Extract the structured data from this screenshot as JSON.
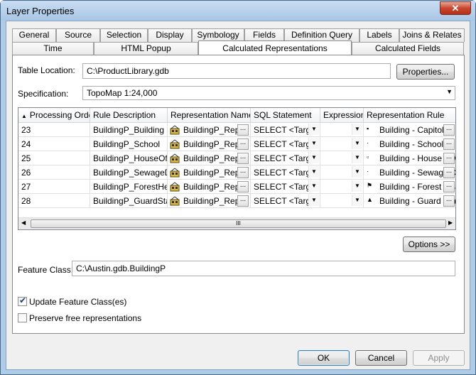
{
  "window": {
    "title": "Layer Properties",
    "close_label": "✕"
  },
  "tabs_row1": [
    "General",
    "Source",
    "Selection",
    "Display",
    "Symbology",
    "Fields",
    "Definition Query",
    "Labels",
    "Joins & Relates"
  ],
  "tabs_row2": [
    "Time",
    "HTML Popup",
    "Calculated Representations",
    "Calculated Fields"
  ],
  "active_tab": "Calculated Representations",
  "table_location": {
    "label": "Table Location:",
    "value": "C:\\ProductLibrary.gdb",
    "button": "Properties..."
  },
  "specification": {
    "label": "Specification:",
    "value": "TopoMap 1:24,000"
  },
  "grid": {
    "columns": [
      "Processing Order",
      "Rule Description",
      "Representation Name",
      "SQL Statement",
      "Expression",
      "Representation Rule"
    ],
    "sort_indicator": "▲",
    "rows": [
      {
        "order": "23",
        "desc": "BuildingP_Building",
        "rep": "BuildingP_Rep",
        "sql": "SELECT <Targe",
        "expr": "",
        "rule": "Building - Capitol"
      },
      {
        "order": "24",
        "desc": "BuildingP_School",
        "rep": "BuildingP_Rep",
        "sql": "SELECT <Targe",
        "expr": "",
        "rule": "Building - School"
      },
      {
        "order": "25",
        "desc": "BuildingP_HouseOfWo",
        "rep": "BuildingP_Rep",
        "sql": "SELECT <Targe",
        "expr": "",
        "rule": "Building - House of W"
      },
      {
        "order": "26",
        "desc": "BuildingP_SewageDis",
        "rep": "BuildingP_Rep",
        "sql": "SELECT <Targe",
        "expr": "",
        "rule": "Building - Sewage D"
      },
      {
        "order": "27",
        "desc": "BuildingP_ForestHead",
        "rep": "BuildingP_Rep",
        "sql": "SELECT <Targe",
        "expr": "",
        "rule": "Building - Forest Hea"
      },
      {
        "order": "28",
        "desc": "BuildingP_GuardStatio",
        "rep": "BuildingP_Rep",
        "sql": "SELECT <Targe",
        "expr": "",
        "rule": "Building - Guard Sta"
      }
    ],
    "ellipsis": "...",
    "dropdown": "▼",
    "scroll_grip": "III"
  },
  "options_button": "Options >>",
  "feature_class": {
    "label": "Feature Class:",
    "value": "C:\\Austin.gdb.BuildingP"
  },
  "update_feature_class": {
    "label": "Update Feature Class(es)",
    "checked": true
  },
  "preserve_free": {
    "label": "Preserve free representations",
    "checked": false
  },
  "buttons": {
    "ok": "OK",
    "cancel": "Cancel",
    "apply": "Apply"
  }
}
